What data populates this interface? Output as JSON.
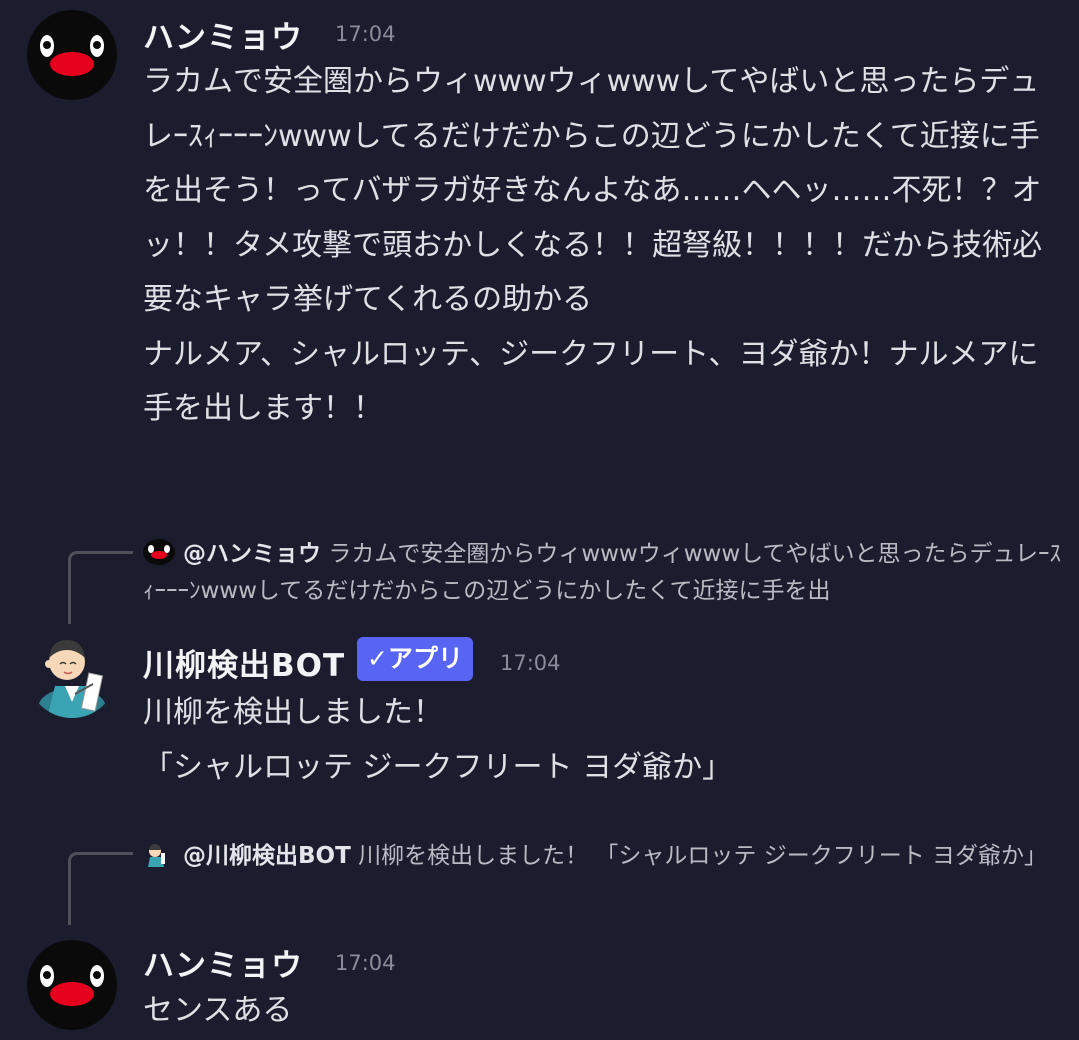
{
  "messages": [
    {
      "author": "ハンミョウ",
      "time": "17:04",
      "content": "ラカムで安全圏からウィwwwウィwwwしてやばいと思ったらデュレｰｽｨｰｰｰﾝwwwしてるだけだからこの辺どうにかしたくて近接に手を出そう！ってバザラガ好きなんよなあ……ヘヘッ……不死！？オッ！！タメ攻撃で頭おかしくなる！！超弩級！！！！だから技術必要なキャラ挙げてくれるの助かる\nナルメア、シャルロッテ、ジークフリート、ヨダ爺か！ナルメアに手を出します！！"
    },
    {
      "reply": {
        "author": "@ハンミョウ",
        "text": "ラカムで安全圏からウィwwwウィwwwしてやばいと思ったらデュレｰｽｨｰｰｰﾝwwwしてるだけだからこの辺どうにかしたくて近接に手を出"
      },
      "author": "川柳検出BOT",
      "badge": "✓アプリ",
      "time": "17:04",
      "content": "川柳を検出しました！\n「シャルロッテ ジークフリート ヨダ爺か」"
    },
    {
      "reply": {
        "author": "@川柳検出BOT",
        "text": "川柳を検出しました！ 「シャルロッテ ジークフリート ヨダ爺か」"
      },
      "author": "ハンミョウ",
      "time": "17:04",
      "content": "センスある"
    }
  ],
  "colors": {
    "background": "#1b1c2e",
    "badge": "#5865f2",
    "username": "#f2f3f5",
    "timestamp": "#8a8c99"
  }
}
